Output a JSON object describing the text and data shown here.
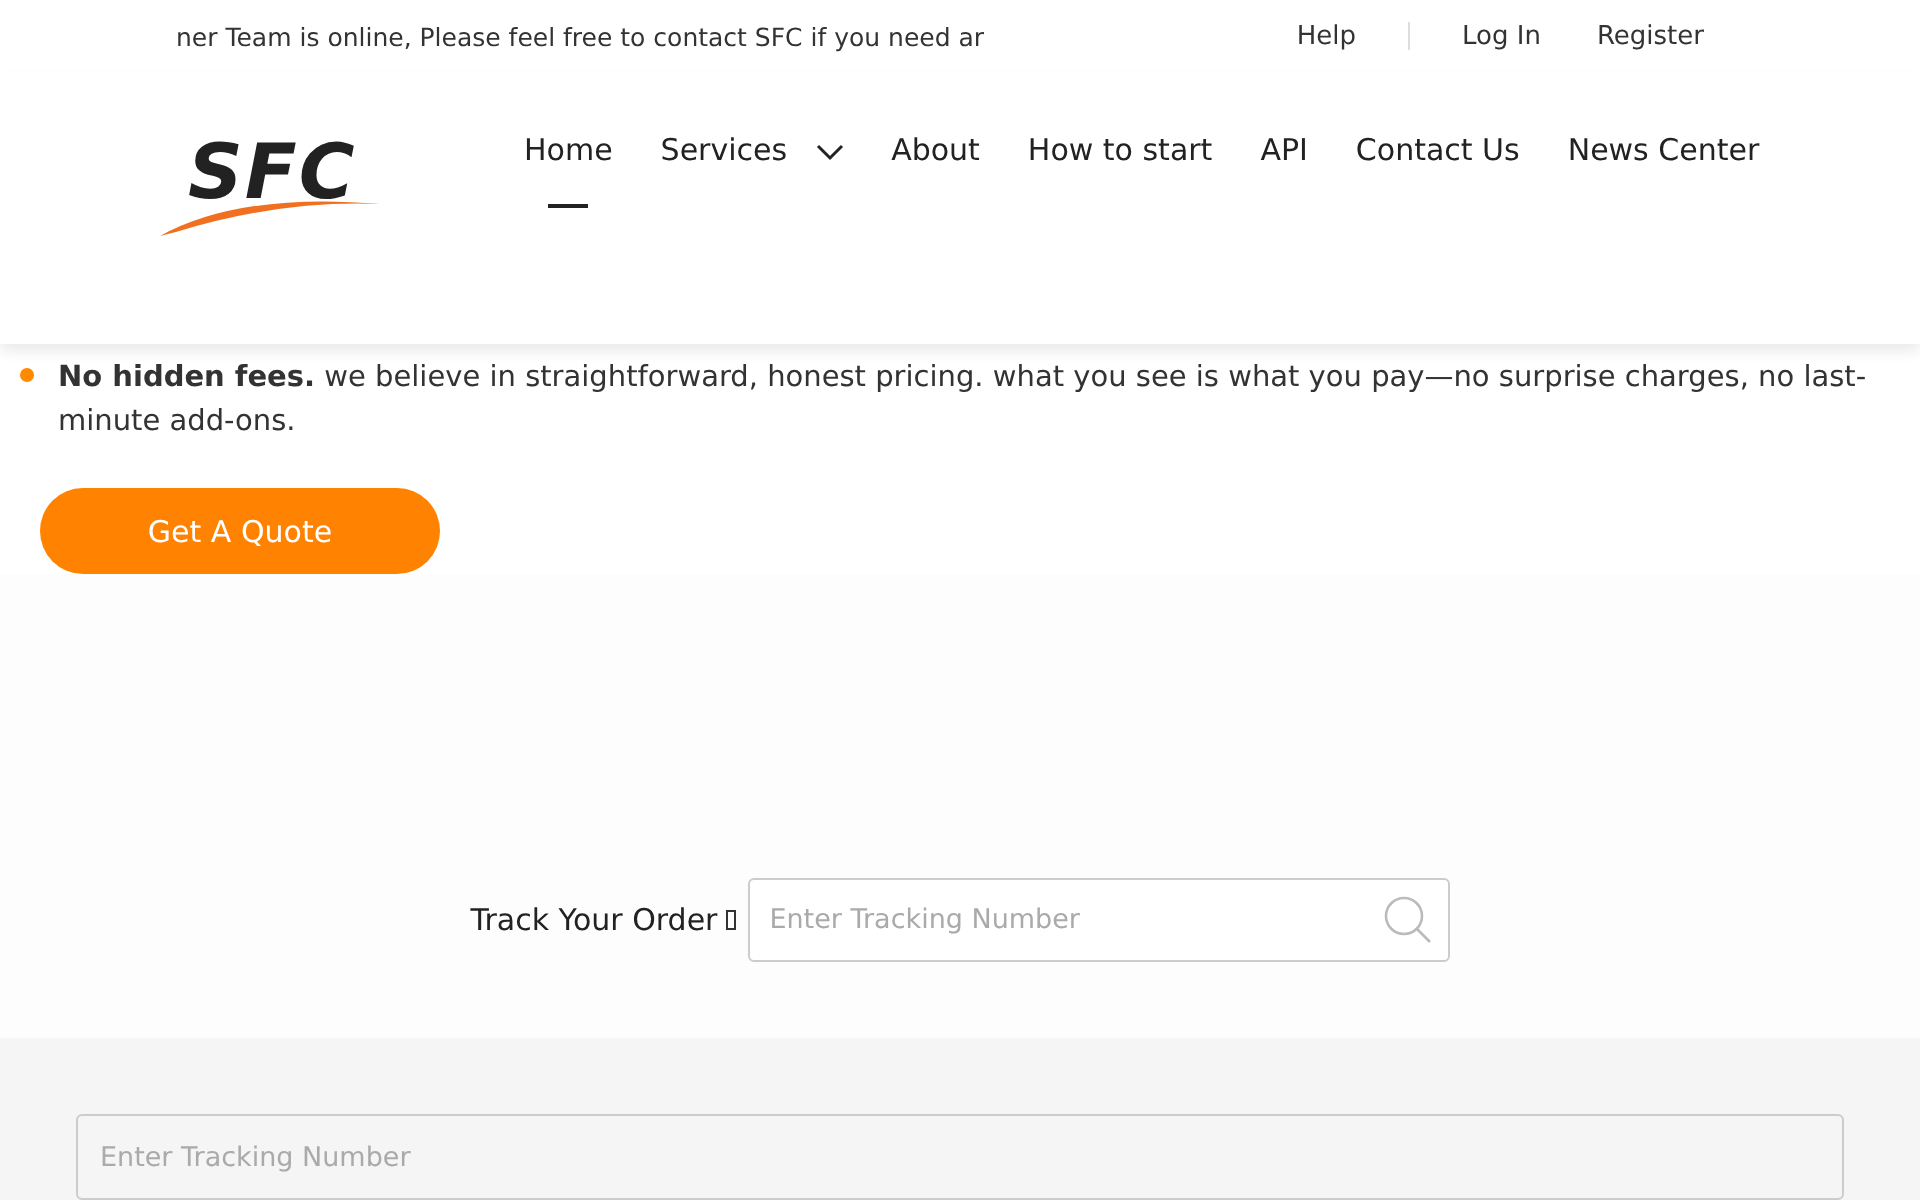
{
  "top_bar": {
    "notice": "ner Team is online, Please feel free to contact SFC if you need ar",
    "links": [
      "Help",
      "Log In",
      "Register"
    ]
  },
  "logo": {
    "text": "SFC"
  },
  "nav": [
    {
      "label": "Home",
      "selected": true,
      "has_menu": false
    },
    {
      "label": "Services",
      "selected": false,
      "has_menu": true
    },
    {
      "label": "About",
      "selected": false,
      "has_menu": false
    },
    {
      "label": "How to start",
      "selected": false,
      "has_menu": false
    },
    {
      "label": "API",
      "selected": false,
      "has_menu": false
    },
    {
      "label": "Contact Us",
      "selected": false,
      "has_menu": false
    },
    {
      "label": "News Center",
      "selected": false,
      "has_menu": false
    }
  ],
  "feature": {
    "text": "**No hidden fees.** we believe in straightforward, honest pricing. what you see is what you pay—no surprise charges, no last-minute add-ons."
  },
  "quote_button": "Get A Quote",
  "track": {
    "label": "Track Your Order",
    "placeholder": "Enter Tracking Number"
  },
  "bottom_search": {
    "placeholder": "Enter Tracking Number"
  }
}
